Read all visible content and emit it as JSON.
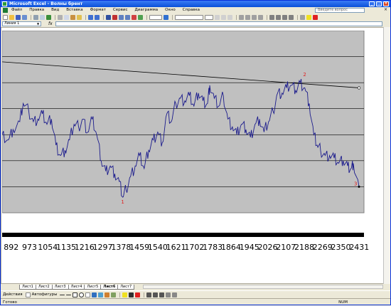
{
  "window": {
    "title": "Microsoft Excel - Волны брент"
  },
  "menu": [
    "Файл",
    "Правка",
    "Вид",
    "Вставка",
    "Формат",
    "Сервис",
    "Диаграмма",
    "Окно",
    "Справка"
  ],
  "ask_placeholder": "Введите вопрос",
  "name_box": "Линия 1",
  "fx_label": "fx",
  "sheets": [
    "Лист1",
    "Лист2",
    "Лист3",
    "Лист4",
    "Лист5",
    "Лист6",
    "Лист7"
  ],
  "active_sheet": "Лист6",
  "draw_toolbar": {
    "actions": "Действия",
    "autoshapes": "Автофигуры"
  },
  "status": {
    "left": "Готово",
    "num": "NUM"
  },
  "colors": {
    "accent": "#0a50d8",
    "series": "#1a1a8c",
    "plot_bg": "#c0c0c0",
    "marker": "#e02020"
  },
  "chart_data": {
    "type": "line",
    "x_ticks": [
      "892",
      "973",
      "1054",
      "1135",
      "1216",
      "1297",
      "1378",
      "1459",
      "1540",
      "1621",
      "1702",
      "1783",
      "1864",
      "1945",
      "2026",
      "2107",
      "2188",
      "2269",
      "2350",
      "2431"
    ],
    "xlim": [
      852,
      2452
    ],
    "ylim": [
      0,
      7
    ],
    "series": [
      {
        "points": [
          [
            852,
            3.0
          ],
          [
            880,
            2.8
          ],
          [
            900,
            3.2
          ],
          [
            930,
            3.5
          ],
          [
            945,
            4.2
          ],
          [
            970,
            3.9
          ],
          [
            990,
            3.5
          ],
          [
            1010,
            3.6
          ],
          [
            1030,
            3.8
          ],
          [
            1050,
            3.4
          ],
          [
            1070,
            3.6
          ],
          [
            1090,
            2.6
          ],
          [
            1110,
            2.2
          ],
          [
            1130,
            2.4
          ],
          [
            1150,
            2.8
          ],
          [
            1170,
            3.4
          ],
          [
            1190,
            3.3
          ],
          [
            1210,
            3.6
          ],
          [
            1230,
            3.1
          ],
          [
            1250,
            3.6
          ],
          [
            1270,
            3.0
          ],
          [
            1290,
            2.0
          ],
          [
            1310,
            1.6
          ],
          [
            1330,
            1.8
          ],
          [
            1350,
            1.5
          ],
          [
            1370,
            1.2
          ],
          [
            1385,
            0.6
          ],
          [
            1400,
            0.9
          ],
          [
            1420,
            1.4
          ],
          [
            1440,
            1.8
          ],
          [
            1460,
            2.2
          ],
          [
            1480,
            1.7
          ],
          [
            1500,
            2.4
          ],
          [
            1520,
            2.8
          ],
          [
            1540,
            3.1
          ],
          [
            1560,
            2.7
          ],
          [
            1580,
            3.8
          ],
          [
            1600,
            3.5
          ],
          [
            1620,
            4.2
          ],
          [
            1640,
            4.4
          ],
          [
            1660,
            4.3
          ],
          [
            1680,
            4.5
          ],
          [
            1700,
            4.1
          ],
          [
            1720,
            4.6
          ],
          [
            1740,
            4.3
          ],
          [
            1760,
            4.2
          ],
          [
            1770,
            4.9
          ],
          [
            1790,
            4.4
          ],
          [
            1810,
            4.1
          ],
          [
            1830,
            4.5
          ],
          [
            1850,
            3.6
          ],
          [
            1870,
            3.3
          ],
          [
            1890,
            3.0
          ],
          [
            1910,
            3.4
          ],
          [
            1930,
            3.2
          ],
          [
            1950,
            2.9
          ],
          [
            1970,
            3.4
          ],
          [
            1990,
            3.6
          ],
          [
            2010,
            3.1
          ],
          [
            2030,
            3.5
          ],
          [
            2050,
            3.9
          ],
          [
            2070,
            4.6
          ],
          [
            2090,
            4.6
          ],
          [
            2110,
            4.8
          ],
          [
            2130,
            4.9
          ],
          [
            2150,
            4.7
          ],
          [
            2170,
            5.0
          ],
          [
            2190,
            4.8
          ],
          [
            2210,
            4.2
          ],
          [
            2230,
            3.0
          ],
          [
            2245,
            2.6
          ],
          [
            2260,
            2.4
          ],
          [
            2280,
            2.2
          ],
          [
            2300,
            2.2
          ],
          [
            2320,
            2.1
          ],
          [
            2340,
            1.9
          ],
          [
            2360,
            2.0
          ],
          [
            2380,
            1.8
          ],
          [
            2395,
            1.7
          ],
          [
            2405,
            1.9
          ],
          [
            2430,
            1.0
          ]
        ]
      }
    ],
    "trend_line": [
      [
        852,
        5.8
      ],
      [
        2430,
        4.8
      ]
    ],
    "annotations": [
      {
        "label": "1",
        "x": 1385,
        "y": 0.35
      },
      {
        "label": "2",
        "x": 2190,
        "y": 5.25
      },
      {
        "label": "3",
        "x": 2415,
        "y": 1.05
      }
    ],
    "grid": true
  }
}
